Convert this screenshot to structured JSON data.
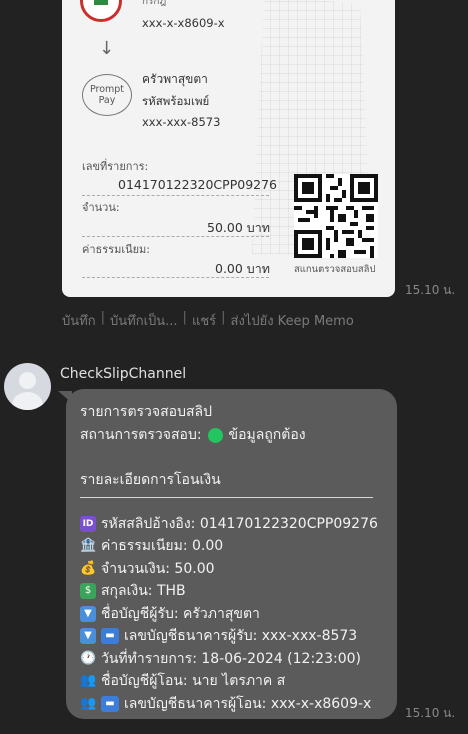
{
  "slip": {
    "sender_account": "xxx-x-x8609-x",
    "promptpay_label_1": "Prompt",
    "promptpay_label_2": "Pay",
    "receiver_name": "ครัวพาสุขตา",
    "receiver_type": "รหัสพร้อมเพย์",
    "receiver_account": "xxx-xxx-8573",
    "ref_label": "เลขที่รายการ:",
    "ref_value": "014170122320CPP09276",
    "amount_label": "จำนวน:",
    "amount_value": "50.00 บาท",
    "fee_label": "ค่าธรรมเนียม:",
    "fee_value": "0.00 บาท",
    "qr_caption": "สแกนตรวจสอบสลิป"
  },
  "timestamps": {
    "first": "15.10 น.",
    "second": "15.10 น."
  },
  "actions": [
    "บันทึก",
    "บันทึกเป็น...",
    "แชร์",
    "ส่งไปยัง Keep Memo"
  ],
  "chat": {
    "sender_name": "CheckSlipChannel",
    "title": "รายการตรวจสอบสลิป",
    "status_label": "สถานการตรวจสอบ:",
    "status_value": "ข้อมูลถูกต้อง",
    "status_color": "#22c55e",
    "section_title": "รายละเอียดการโอนเงิน",
    "rows": [
      {
        "icon": "id-icon",
        "text": "รหัสสลิปอ้างอิง: 014170122320CPP09276"
      },
      {
        "icon": "bank-icon",
        "text": "ค่าธรรมเนียม: 0.00"
      },
      {
        "icon": "money-bag-icon",
        "text": "จำนวนเงิน: 50.00"
      },
      {
        "icon": "currency-icon",
        "text": "สกุลเงิน: THB"
      },
      {
        "icon": "inbox-icon",
        "text": "ชื่อบัญชีผู้รับ: ครัวภาสุขตา"
      },
      {
        "icon": "inbox-card-icon",
        "text": "เลขบัญชีธนาคารผู้รับ: xxx-xxx-8573"
      },
      {
        "icon": "clock-icon",
        "text": "วันที่ทำรายการ: 18-06-2024 (12:23:00)"
      },
      {
        "icon": "people-icon",
        "text": "ชื่อบัญชีผู้โอน: นาย ไตรภาค ส"
      },
      {
        "icon": "people-card-icon",
        "text": "เลขบัญชีธนาคารผู้โอน: xxx-x-x8609-x"
      }
    ]
  }
}
